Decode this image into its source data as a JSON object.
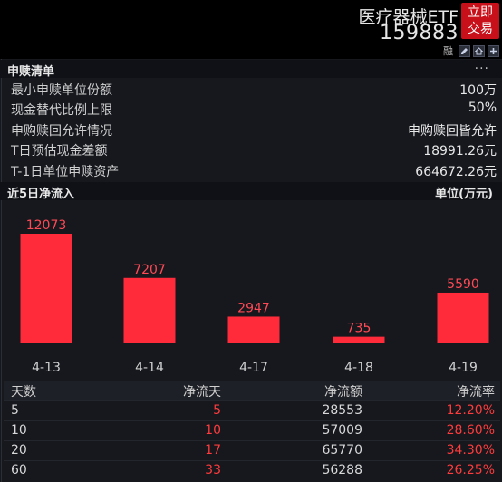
{
  "header": {
    "etf_name": "医疗器械ETF",
    "etf_code": "159883",
    "trade_button_line1": "立即",
    "trade_button_line2": "交易",
    "toolbar_label": "融",
    "toolbar_icons": [
      "edit-icon",
      "home-icon",
      "plus-icon"
    ]
  },
  "subscription": {
    "title": "申赎清单",
    "more": "...",
    "rows": [
      {
        "label": "最小申赎单位份额",
        "value": "100万"
      },
      {
        "label": "现金替代比例上限",
        "value": "50%"
      },
      {
        "label": "申购赎回允许情况",
        "value": "申购赎回皆允许"
      },
      {
        "label": "T日预估现金差额",
        "value": "18991.26元"
      },
      {
        "label": "T-1日单位申赎资产",
        "value": "664672.26元"
      }
    ]
  },
  "inflow": {
    "title": "近5日净流入",
    "unit": "单位(万元)"
  },
  "chart_data": {
    "type": "bar",
    "categories": [
      "4-13",
      "4-14",
      "4-17",
      "4-18",
      "4-19"
    ],
    "values": [
      12073,
      7207,
      2947,
      735,
      5590
    ],
    "bar_color": "#ff2a3a",
    "grid": false
  },
  "stats": {
    "headers": [
      "天数",
      "净流天",
      "净流额",
      "净流率"
    ],
    "rows": [
      [
        "5",
        "5",
        "28553",
        "12.20%"
      ],
      [
        "10",
        "10",
        "57009",
        "28.60%"
      ],
      [
        "20",
        "17",
        "65770",
        "34.30%"
      ],
      [
        "60",
        "33",
        "56288",
        "26.25%"
      ]
    ]
  },
  "colors": {
    "accent_red": "#ff3b3b",
    "trade_button": "#c8101a",
    "panel_bg": "#16181e"
  }
}
